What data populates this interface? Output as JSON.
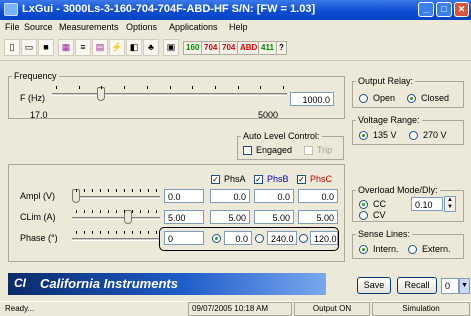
{
  "window": {
    "title": "LxGui - 3000Ls-3-160-704-704F-ABD-HF S/N:  [FW = 1.03]"
  },
  "menu": [
    "File",
    "Source",
    "Measurements",
    "Options",
    "Applications",
    "Help"
  ],
  "toolbar": {
    "t160": "160",
    "t704a": "704",
    "t704b": "704",
    "abd": "ABD",
    "t411": "411",
    "help": "?"
  },
  "frequency": {
    "label": "Frequency",
    "f_label": "F (Hz)",
    "min": "17.0",
    "max": "5000",
    "value": "1000.0",
    "slider_fraction": 0.2
  },
  "output_relay": {
    "label": "Output Relay:",
    "open": "Open",
    "closed": "Closed",
    "selected": "closed"
  },
  "voltage_range": {
    "label": "Voltage Range:",
    "r135": "135 V",
    "r270": "270 V",
    "selected": "135"
  },
  "alc": {
    "label": "Auto Level Control:",
    "engaged": "Engaged",
    "trip": "Trip"
  },
  "phases": {
    "a": "PhsA",
    "b": "PhsB",
    "c": "PhsC",
    "a_color": "#000000",
    "b_color": "#0000cc",
    "c_color": "#cc0000"
  },
  "ampl": {
    "label": "Ampl (V)",
    "all": "0.0",
    "a": "0.0",
    "b": "0.0",
    "c": "0.0",
    "slider_fraction": 0.0
  },
  "clim": {
    "label": "CLim (A)",
    "all": "5.00",
    "a": "5.00",
    "b": "5.00",
    "c": "5.00",
    "slider_fraction": 0.65
  },
  "phase": {
    "label": "Phase (°)",
    "all": "0",
    "a": "0.0",
    "b": "240.0",
    "c": "120.0",
    "slider_fraction": 0.0
  },
  "overload": {
    "label": "Overload Mode/Dly:",
    "cc": "CC",
    "cv": "CV",
    "selected": "cc",
    "delay": "0.10"
  },
  "sense": {
    "label": "Sense Lines:",
    "intern": "Intern.",
    "extern": "Extern.",
    "selected": "intern"
  },
  "brand": {
    "name": "California Instruments",
    "logo": "CI"
  },
  "buttons": {
    "save": "Save",
    "recall": "Recall",
    "recall_value": "0"
  },
  "status": {
    "ready": "Ready...",
    "datetime": "09/07/2005 10:18 AM",
    "output": "Output ON",
    "mode": "Simulation"
  }
}
